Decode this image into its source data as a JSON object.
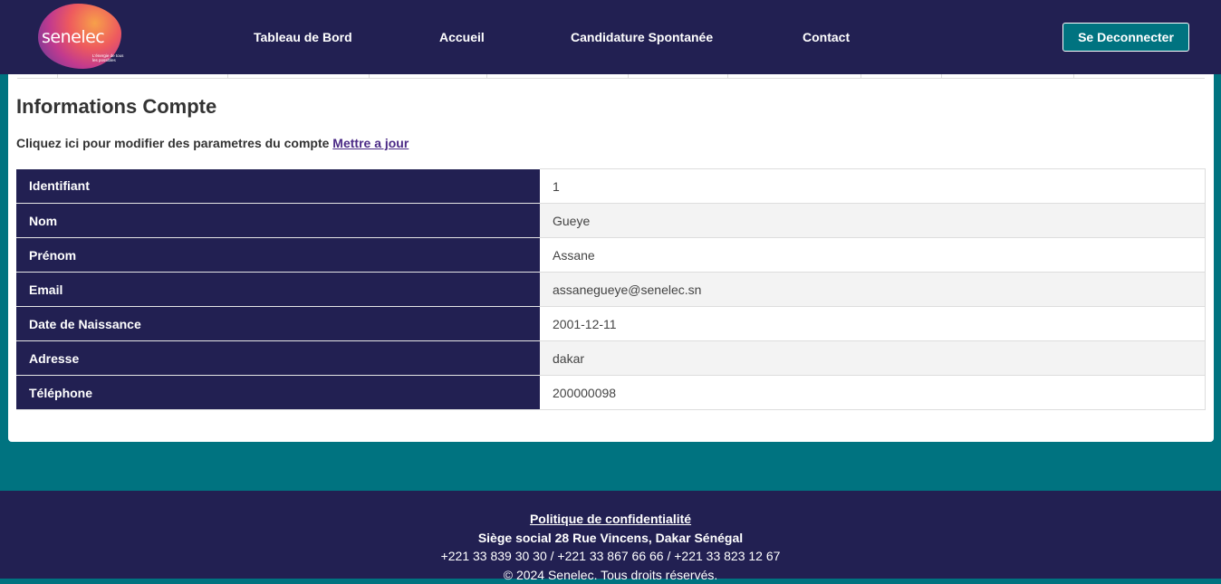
{
  "brand": {
    "logo_text": "senelec",
    "logo_tagline": "L'énergie de tous les possibles"
  },
  "nav": {
    "items": [
      "Tableau de Bord",
      "Accueil",
      "Candidature Spontanée",
      "Contact"
    ],
    "logout_label": "Se Deconnecter"
  },
  "account": {
    "title": "Informations Compte",
    "update_prompt": "Cliquez ici pour modifier des parametres du compte",
    "update_link": "Mettre a jour",
    "rows": [
      {
        "label": "Identifiant",
        "value": "1"
      },
      {
        "label": "Nom",
        "value": "Gueye"
      },
      {
        "label": "Prénom",
        "value": "Assane"
      },
      {
        "label": "Email",
        "value": "assanegueye@senelec.sn"
      },
      {
        "label": "Date de Naissance",
        "value": "2001-12-11"
      },
      {
        "label": "Adresse",
        "value": "dakar"
      },
      {
        "label": "Téléphone",
        "value": "200000098"
      }
    ]
  },
  "footer": {
    "privacy_link": "Politique de confidentialité",
    "address": "Siège social 28 Rue Vincens, Dakar Sénégal",
    "phones": "+221 33 839 30 30 / +221 33 867 66 66 / +221 33 823 12 67",
    "copyright": "© 2024 Senelec. Tous droits réservés."
  },
  "colors": {
    "navy": "#222052",
    "teal": "#007380",
    "link_purple": "#4b2a86"
  }
}
